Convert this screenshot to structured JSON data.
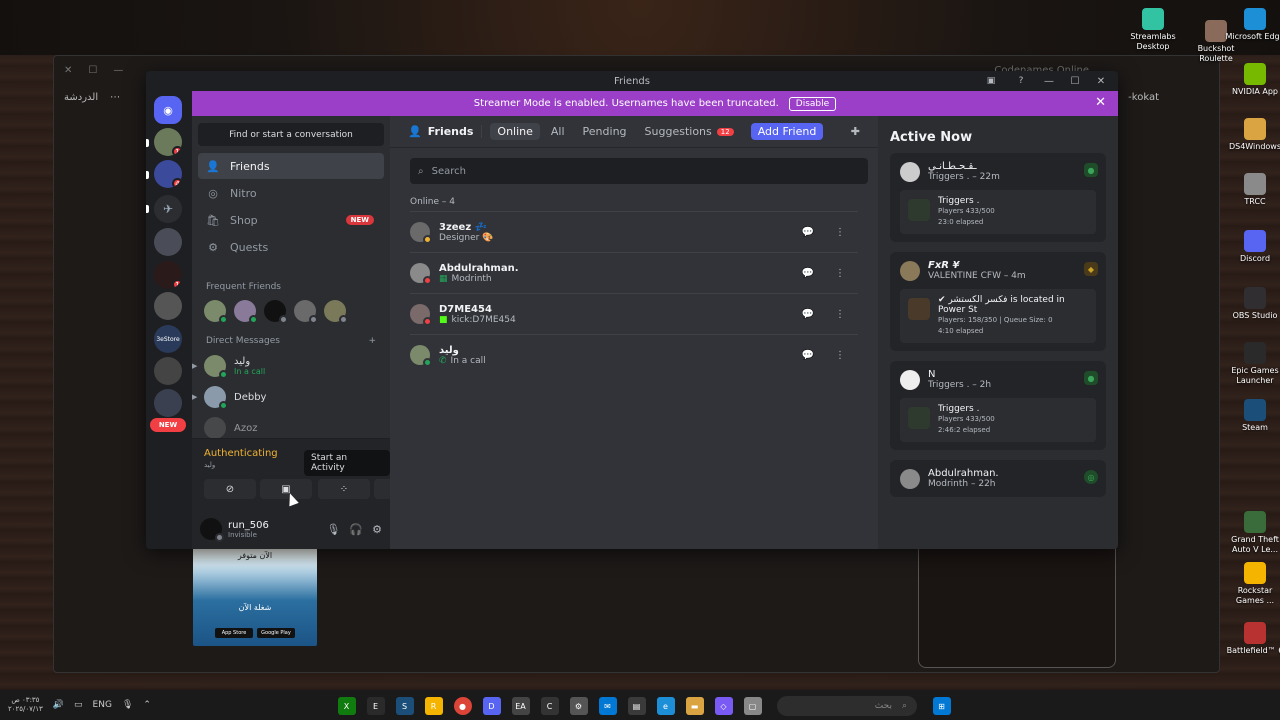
{
  "desktop": {
    "icons": [
      {
        "label": "Streamlabs Desktop",
        "color": "#31c3a2"
      },
      {
        "label": "Buckshot Roulette",
        "color": "#8a6a5a"
      },
      {
        "label": "Microsoft Edge",
        "color": "#1d8fd6"
      },
      {
        "label": "NVIDIA App",
        "color": "#76b900"
      },
      {
        "label": "DS4Windows",
        "color": "#d9a441"
      },
      {
        "label": "TRCC",
        "color": "#8a8a8a"
      },
      {
        "label": "Discord",
        "color": "#5865f2"
      },
      {
        "label": "OBS Studio",
        "color": "#302e31"
      },
      {
        "label": "Epic Games Launcher",
        "color": "#2a2a2a"
      },
      {
        "label": "Steam",
        "color": "#1b4f7a"
      },
      {
        "label": "Grand Theft Auto V Le...",
        "color": "#3a6b3a"
      },
      {
        "label": "Rockstar Games ...",
        "color": "#f4b400"
      },
      {
        "label": "Battlefield™ 6",
        "color": "#b83232"
      }
    ],
    "bg_window": {
      "tab_label": "Codenames Online",
      "chat_label": "الدردشة",
      "url_fragment": "-kokat"
    },
    "promo": {
      "top_text": "الآن متوفر",
      "mid_text": "شغلة الآن",
      "store1": "App Store",
      "store2": "Google Play"
    }
  },
  "discord": {
    "window_title": "Friends",
    "title_controls": [
      "—",
      "☐",
      "✕"
    ],
    "banner": {
      "text": "Streamer Mode is enabled. Usernames have been truncated.",
      "button": "Disable",
      "close": "✕"
    },
    "guilds": {
      "badges": [
        "1",
        "4",
        "1"
      ],
      "new_label": "NEW",
      "store_label": "3eStore"
    },
    "sidebar": {
      "search_placeholder": "Find or start a conversation",
      "nav": [
        {
          "label": "Friends",
          "icon": "friends-icon",
          "glyph": "👤"
        },
        {
          "label": "Nitro",
          "icon": "nitro-icon",
          "glyph": "◎"
        },
        {
          "label": "Shop",
          "icon": "shop-icon",
          "glyph": "🛍",
          "badge": "NEW"
        },
        {
          "label": "Quests",
          "icon": "quests-icon",
          "glyph": "⚙"
        }
      ],
      "frequent_friends_label": "Frequent Friends",
      "direct_messages_label": "Direct Messages",
      "add_dm": "+",
      "dms": [
        {
          "name": "وليد",
          "status": "In a call"
        },
        {
          "name": "Debby",
          "status": ""
        },
        {
          "name": "Azoz",
          "status": ""
        }
      ]
    },
    "voice": {
      "status": "Authenticating",
      "sub": "وليد",
      "tooltip": "Start an Activity"
    },
    "user": {
      "name": "run_506",
      "status": "Invisible"
    },
    "friends": {
      "title": "Friends",
      "tabs": [
        {
          "label": "Online"
        },
        {
          "label": "All"
        },
        {
          "label": "Pending"
        },
        {
          "label": "Suggestions",
          "count": "12"
        }
      ],
      "add_friend": "Add Friend",
      "search_placeholder": "Search",
      "online_header": "Online – 4",
      "list": [
        {
          "name": "3zeez 💤",
          "sub": "Designer 🎨",
          "status_color": "#f0b232"
        },
        {
          "name": "Abdulrahman.",
          "sub": "Modrinth",
          "status_color": "#f23f43"
        },
        {
          "name": "D7ME454",
          "sub": "kick:D7ME454",
          "status_color": "#f23f43"
        },
        {
          "name": "وليد",
          "sub": "In a call",
          "status_color": "#23a559"
        }
      ]
    },
    "active_now": {
      "title": "Active Now",
      "cards": [
        {
          "name": "ـقـحـطـانـي",
          "sub": "Triggers . – 22m",
          "activity": "Triggers .",
          "detail1": "Players 433/500",
          "detail2": "23:0 elapsed"
        },
        {
          "name": "FxR ¥",
          "sub": "VALENTINE CFW – 4m",
          "activity": "✔ فكسر الكستشر is located in Power St",
          "detail1": "Players: 158/350 | Queue Size: 0",
          "detail2": "4:10 elapsed"
        },
        {
          "name": "N",
          "sub": "Triggers . – 2h",
          "activity": "Triggers .",
          "detail1": "Players 433/500",
          "detail2": "2:46:2 elapsed"
        },
        {
          "name": "Abdulrahman.",
          "sub": "Modrinth – 22h",
          "activity": "",
          "detail1": "",
          "detail2": ""
        }
      ]
    }
  },
  "taskbar": {
    "time": "٠٣:٣٥ ص",
    "date": "٢٠٢٥/٠٧/١٣",
    "lang": "ENG",
    "search_placeholder": "بحث",
    "apps": [
      "xbox-icon",
      "epic-icon",
      "steam-icon",
      "rockstar-icon",
      "chrome-icon",
      "discord-icon",
      "ea-icon",
      "ctrl-icon",
      "settings-icon",
      "mail-icon",
      "store-icon",
      "edge-icon",
      "explorer-icon",
      "copilot-icon",
      "window-icon"
    ]
  }
}
